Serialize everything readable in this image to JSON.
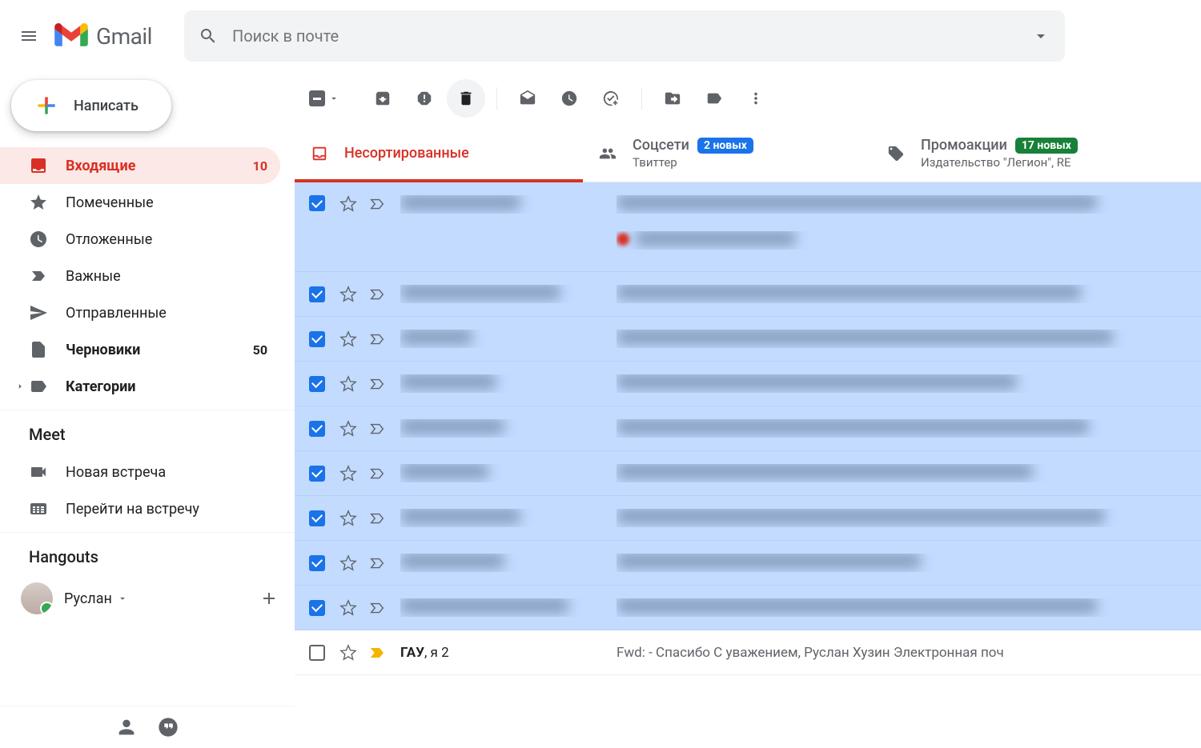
{
  "header": {
    "logo_text": "Gmail",
    "search_placeholder": "Поиск в почте"
  },
  "compose": {
    "label": "Написать"
  },
  "sidebar": {
    "items": [
      {
        "icon": "inbox",
        "label": "Входящие",
        "count": "10",
        "active": true,
        "bold": true
      },
      {
        "icon": "star",
        "label": "Помеченные"
      },
      {
        "icon": "clock",
        "label": "Отложенные"
      },
      {
        "icon": "important",
        "label": "Важные"
      },
      {
        "icon": "send",
        "label": "Отправленные"
      },
      {
        "icon": "file",
        "label": "Черновики",
        "count": "50",
        "bold": true
      },
      {
        "icon": "label",
        "label": "Категории",
        "bold": true,
        "arrow": true
      }
    ]
  },
  "meet": {
    "section_title": "Meet",
    "items": [
      {
        "icon": "video",
        "label": "Новая встреча"
      },
      {
        "icon": "keyboard",
        "label": "Перейти на встречу"
      }
    ]
  },
  "hangouts": {
    "section_title": "Hangouts",
    "user_name": "Руслан"
  },
  "tabs": [
    {
      "icon": "inbox",
      "title": "Несортированные",
      "active": true
    },
    {
      "icon": "people",
      "title": "Соцсети",
      "badge": "2 новых",
      "badge_color": "blue",
      "sub": "Твиттер"
    },
    {
      "icon": "tag",
      "title": "Промоакции",
      "badge": "17 новых",
      "badge_color": "green",
      "sub": "Издательство \"Легион\", RE"
    }
  ],
  "emails": {
    "last_row": {
      "sender_prefix": "ГАУ",
      "sender_suffix": ", я 2",
      "subject_prefix": "Fwd:",
      "subject_body": " - Спасибо С уважением, Руслан Хузин Электронная поч"
    }
  },
  "toolbar": {
    "buttons": [
      "archive",
      "spam",
      "delete",
      "mark-read",
      "snooze",
      "add-task",
      "move",
      "label",
      "more"
    ]
  }
}
